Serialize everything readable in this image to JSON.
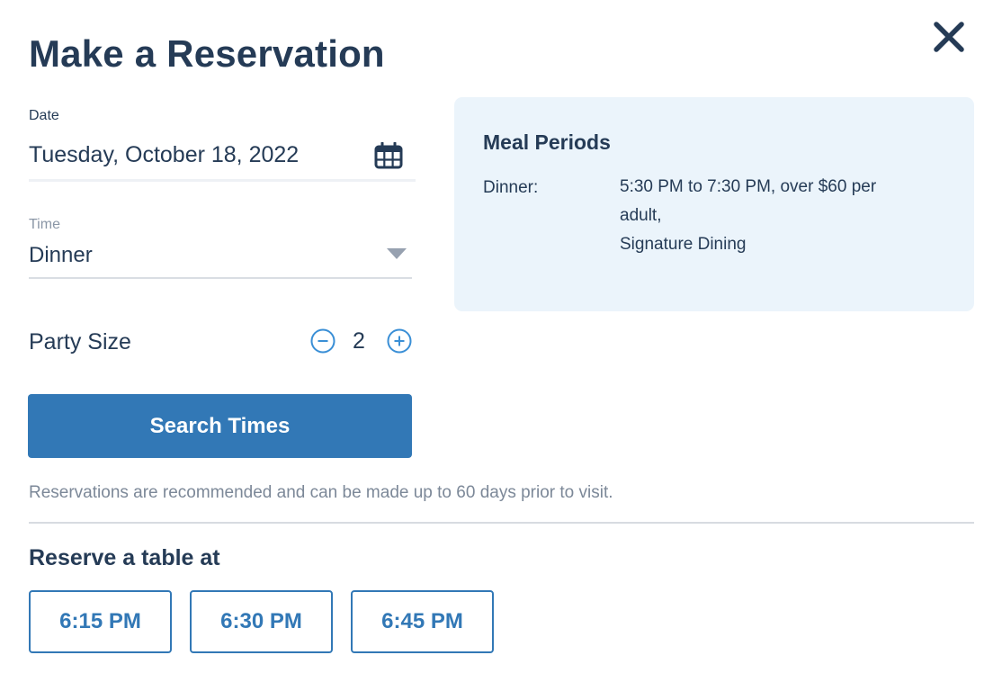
{
  "dialog": {
    "title": "Make a Reservation",
    "close_icon": "close-icon"
  },
  "form": {
    "date": {
      "label": "Date",
      "value": "Tuesday, October 18, 2022",
      "icon": "calendar-icon"
    },
    "time": {
      "label": "Time",
      "selected": "Dinner",
      "icon": "dropdown-arrow-icon"
    },
    "party_size": {
      "label": "Party Size",
      "value": "2",
      "decrement_icon": "minus-circle-icon",
      "increment_icon": "plus-circle-icon"
    },
    "search_button": "Search Times",
    "note": "Reservations are recommended and can be made up to 60 days prior to visit."
  },
  "meal_periods": {
    "title": "Meal Periods",
    "items": [
      {
        "name": "Dinner:",
        "lines": [
          "5:30 PM to 7:30 PM, over $60 per",
          "adult,",
          "Signature Dining"
        ]
      }
    ]
  },
  "reserve": {
    "heading": "Reserve a table at",
    "times": [
      "6:15 PM",
      "6:30 PM",
      "6:45 PM"
    ]
  },
  "colors": {
    "primary_text": "#253b56",
    "accent_blue": "#3278b6",
    "card_bg": "#ebf4fb",
    "muted_text": "#7c8898"
  }
}
